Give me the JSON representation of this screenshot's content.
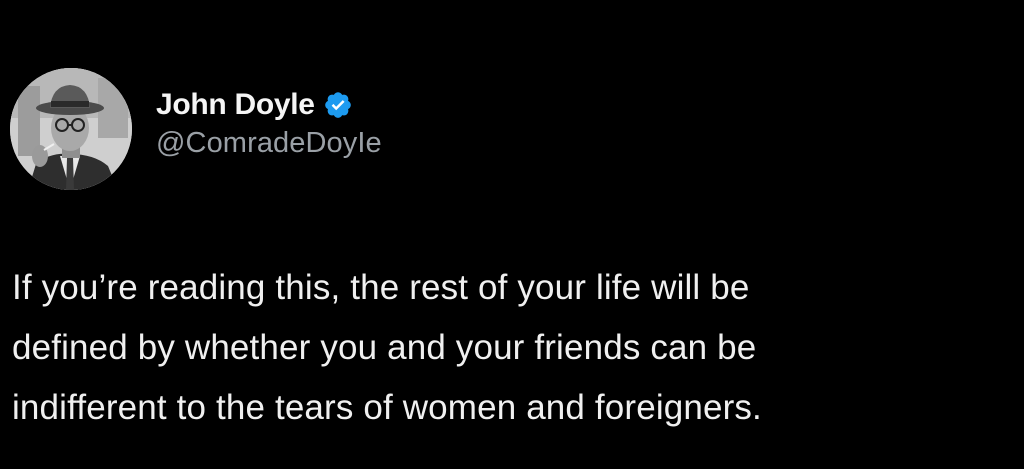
{
  "author": {
    "display_name": "John Doyle",
    "handle": "@ComradeDoyIe",
    "verified": true,
    "avatar_icon": "avatar-photo",
    "verified_icon": "verified-badge-icon",
    "verified_color": "#1d9bf0"
  },
  "tweet": {
    "lines": [
      "If you’re reading this, the rest of your life will be",
      "defined by whether you and your friends can be",
      "indifferent to the tears of women and foreigners."
    ]
  },
  "theme": {
    "background": "#000000",
    "text": "#f0f0f0",
    "secondary_text": "#9aa0a6"
  }
}
